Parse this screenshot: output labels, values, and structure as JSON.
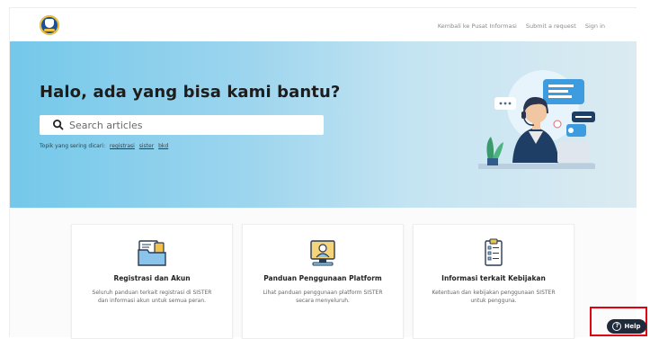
{
  "nav": {
    "items": [
      "Kembali ke Pusat Informasi",
      "Submit a request",
      "Sign in"
    ]
  },
  "hero": {
    "title": "Halo, ada yang bisa kami bantu?",
    "search_placeholder": "Search articles",
    "topics_label": "Topik yang sering dicari:",
    "topics": [
      "registrasi",
      "sister",
      "bkd"
    ]
  },
  "cards": [
    {
      "title": "Registrasi dan Akun",
      "description": "Seluruh panduan terkait registrasi di SISTER dan informasi akun untuk semua peran."
    },
    {
      "title": "Panduan Penggunaan Platform",
      "description": "Lihat panduan penggunaan platform SISTER secara menyeluruh."
    },
    {
      "title": "Informasi terkait Kebijakan",
      "description": "Ketentuan dan kebijakan penggunaan SISTER untuk pengguna."
    }
  ],
  "help": {
    "label": "Help",
    "icon": "question-circle-icon"
  },
  "colors": {
    "hero_left": "#74c8ea",
    "hero_right": "#dcebf1",
    "help_bg": "#1f2b3a",
    "highlight": "#e1000f"
  }
}
